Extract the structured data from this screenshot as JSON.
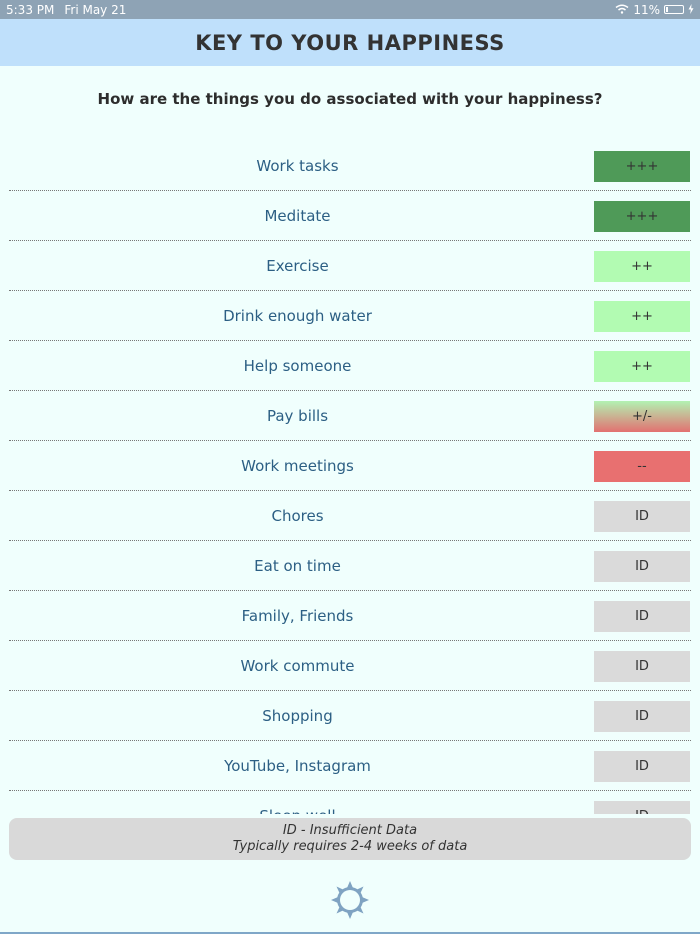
{
  "status_bar": {
    "time": "5:33 PM",
    "date": "Fri May 21",
    "battery": "11%"
  },
  "header": {
    "title": "KEY TO YOUR HAPPINESS"
  },
  "question": "How are the things you do associated with your happiness?",
  "items": [
    {
      "label": "Work tasks",
      "rating": "+++",
      "level": "ppp"
    },
    {
      "label": "Meditate",
      "rating": "+++",
      "level": "ppp"
    },
    {
      "label": "Exercise",
      "rating": "++",
      "level": "pp"
    },
    {
      "label": "Drink enough water",
      "rating": "++",
      "level": "pp"
    },
    {
      "label": "Help someone",
      "rating": "++",
      "level": "pp"
    },
    {
      "label": "Pay bills",
      "rating": "+/-",
      "level": "pm"
    },
    {
      "label": "Work meetings",
      "rating": "--",
      "level": "mm"
    },
    {
      "label": "Chores",
      "rating": "ID",
      "level": "id"
    },
    {
      "label": "Eat on time",
      "rating": "ID",
      "level": "id"
    },
    {
      "label": "Family, Friends",
      "rating": "ID",
      "level": "id"
    },
    {
      "label": "Work commute",
      "rating": "ID",
      "level": "id"
    },
    {
      "label": "Shopping",
      "rating": "ID",
      "level": "id"
    },
    {
      "label": "YouTube, Instagram",
      "rating": "ID",
      "level": "id"
    },
    {
      "label": "Sleep well",
      "rating": "ID",
      "level": "id"
    }
  ],
  "legend": {
    "line1": "ID - Insufficient Data",
    "line2": "Typically requires 2-4 weeks of data"
  },
  "colors": {
    "strong_positive": "#4f9a58",
    "positive": "#b2fbb2",
    "negative": "#e87070",
    "insufficient": "#dadada",
    "header_bg": "#bfe0fb",
    "page_bg": "#f0fffd"
  },
  "icons": {
    "settings": "sun-gear-icon"
  }
}
